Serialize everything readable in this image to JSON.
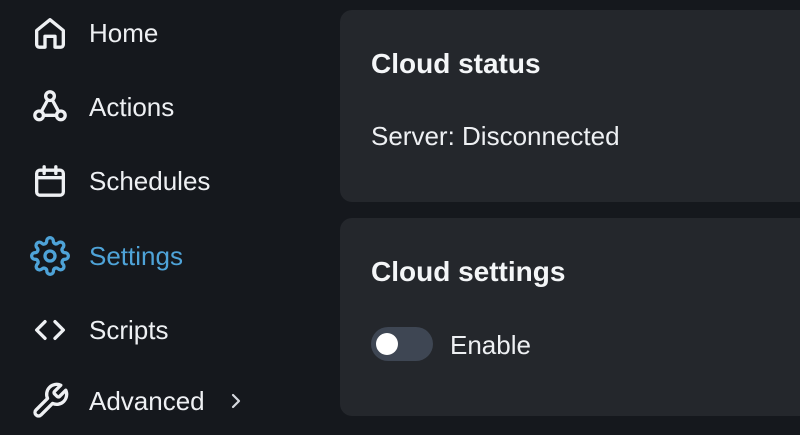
{
  "theme": {
    "accent": "#4ea3d8",
    "background": "#15181d",
    "card": "#24272c",
    "toggle_off": "#3e4653"
  },
  "sidebar": {
    "items": [
      {
        "label": "Home",
        "icon": "home-icon",
        "active": false
      },
      {
        "label": "Actions",
        "icon": "webhook-icon",
        "active": false
      },
      {
        "label": "Schedules",
        "icon": "calendar-icon",
        "active": false
      },
      {
        "label": "Settings",
        "icon": "gear-icon",
        "active": true
      },
      {
        "label": "Scripts",
        "icon": "code-icon",
        "active": false
      },
      {
        "label": "Advanced",
        "icon": "wrench-icon",
        "active": false,
        "has_submenu": true
      }
    ]
  },
  "cloud_status": {
    "title": "Cloud status",
    "server_text": "Server: Disconnected"
  },
  "cloud_settings": {
    "title": "Cloud settings",
    "enable_label": "Enable",
    "enabled": false
  }
}
